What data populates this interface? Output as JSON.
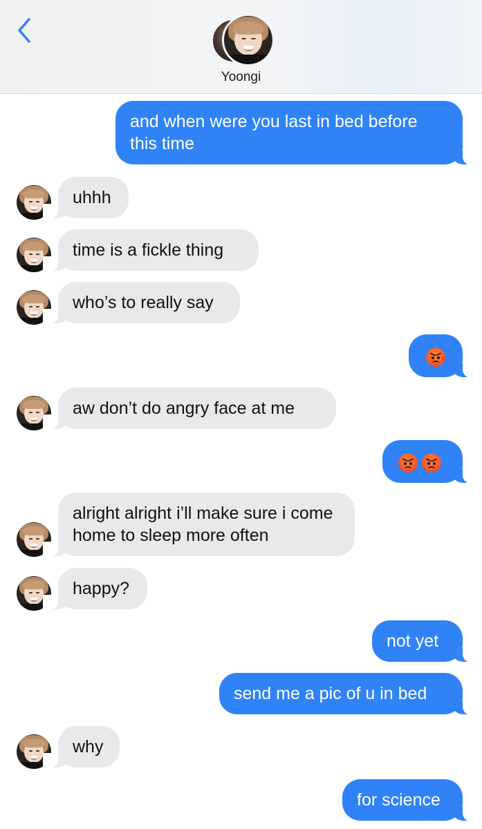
{
  "header": {
    "contact_name": "Yoongi",
    "back_icon": "chevron-left-icon",
    "accent_color": "#2f83f6"
  },
  "conversation": [
    {
      "from": "me",
      "text": "and when were you last in bed before this time"
    },
    {
      "from": "them",
      "text": "uhhh"
    },
    {
      "from": "them",
      "text": "time is a fickle thing"
    },
    {
      "from": "them",
      "text": "who’s to really say"
    },
    {
      "from": "me",
      "emoji": [
        "angry-face-icon"
      ]
    },
    {
      "from": "them",
      "text": "aw don’t do angry face at me"
    },
    {
      "from": "me",
      "emoji": [
        "angry-face-icon",
        "angry-face-icon"
      ]
    },
    {
      "from": "them",
      "text": "alright alright i’ll make sure i come home to sleep more often"
    },
    {
      "from": "them",
      "text": "happy?"
    },
    {
      "from": "me",
      "text": "not yet"
    },
    {
      "from": "me",
      "text": "send me a pic of u in bed"
    },
    {
      "from": "them",
      "text": "why"
    },
    {
      "from": "me",
      "text": "for science"
    }
  ],
  "colors": {
    "sent_bubble": "#2f83f6",
    "received_bubble": "#e9e9eb"
  }
}
